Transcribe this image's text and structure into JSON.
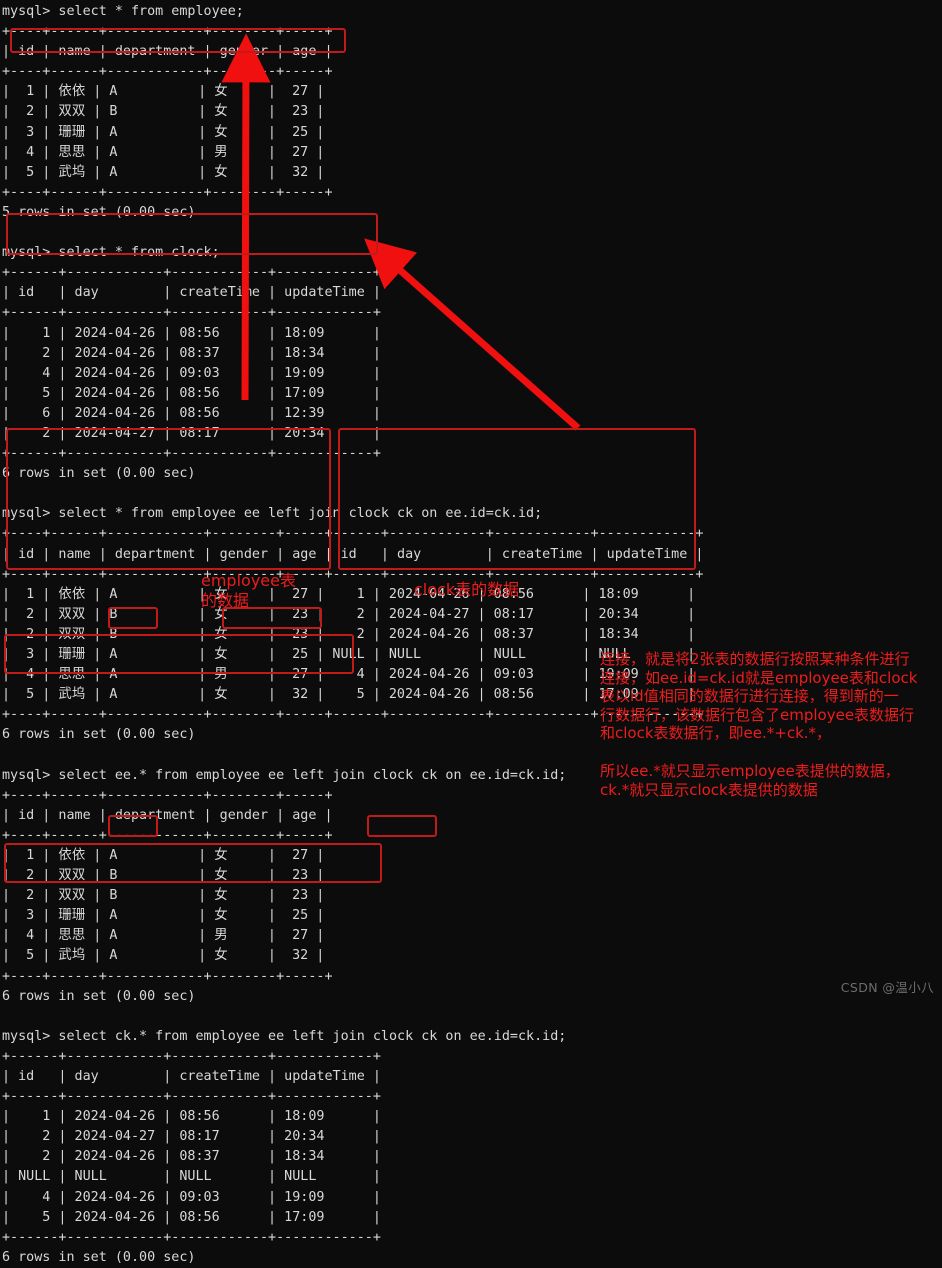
{
  "terminal": {
    "lines": [
      "mysql> select * from employee;",
      "+----+------+------------+--------+-----+",
      "| id | name | department | gender | age |",
      "+----+------+------------+--------+-----+",
      "|  1 | 依依 | A          | 女     |  27 |",
      "|  2 | 双双 | B          | 女     |  23 |",
      "|  3 | 珊珊 | A          | 女     |  25 |",
      "|  4 | 思思 | A          | 男     |  27 |",
      "|  5 | 武坞 | A          | 女     |  32 |",
      "+----+------+------------+--------+-----+",
      "5 rows in set (0.00 sec)",
      "",
      "mysql> select * from clock;",
      "+------+------------+------------+------------+",
      "| id   | day        | createTime | updateTime |",
      "+------+------------+------------+------------+",
      "|    1 | 2024-04-26 | 08:56      | 18:09      |",
      "|    2 | 2024-04-26 | 08:37      | 18:34      |",
      "|    4 | 2024-04-26 | 09:03      | 19:09      |",
      "|    5 | 2024-04-26 | 08:56      | 17:09      |",
      "|    6 | 2024-04-26 | 08:56      | 12:39      |",
      "|    2 | 2024-04-27 | 08:17      | 20:34      |",
      "+------+------------+------------+------------+",
      "6 rows in set (0.00 sec)",
      "",
      "mysql> select * from employee ee left join clock ck on ee.id=ck.id;",
      "+----+------+------------+--------+-----+------+------------+------------+------------+",
      "| id | name | department | gender | age | id   | day        | createTime | updateTime |",
      "+----+------+------------+--------+-----+------+------------+------------+------------+",
      "|  1 | 依依 | A          | 女     |  27 |    1 | 2024-04-26 | 08:56      | 18:09      |",
      "|  2 | 双双 | B          | 女     |  23 |    2 | 2024-04-27 | 08:17      | 20:34      |",
      "|  2 | 双双 | B          | 女     |  23 |    2 | 2024-04-26 | 08:37      | 18:34      |",
      "|  3 | 珊珊 | A          | 女     |  25 | NULL | NULL       | NULL       | NULL       |",
      "|  4 | 思思 | A          | 男     |  27 |    4 | 2024-04-26 | 09:03      | 19:09      |",
      "|  5 | 武坞 | A          | 女     |  32 |    5 | 2024-04-26 | 08:56      | 17:09      |",
      "+----+------+------------+--------+-----+------+------------+------------+------------+",
      "6 rows in set (0.00 sec)",
      "",
      "mysql> select ee.* from employee ee left join clock ck on ee.id=ck.id;",
      "+----+------+------------+--------+-----+",
      "| id | name | department | gender | age |",
      "+----+------+------------+--------+-----+",
      "|  1 | 依依 | A          | 女     |  27 |",
      "|  2 | 双双 | B          | 女     |  23 |",
      "|  2 | 双双 | B          | 女     |  23 |",
      "|  3 | 珊珊 | A          | 女     |  25 |",
      "|  4 | 思思 | A          | 男     |  27 |",
      "|  5 | 武坞 | A          | 女     |  32 |",
      "+----+------+------------+--------+-----+",
      "6 rows in set (0.00 sec)",
      "",
      "mysql> select ck.* from employee ee left join clock ck on ee.id=ck.id;",
      "+------+------------+------------+------------+",
      "| id   | day        | createTime | updateTime |",
      "+------+------------+------------+------------+",
      "|    1 | 2024-04-26 | 08:56      | 18:09      |",
      "|    2 | 2024-04-27 | 08:17      | 20:34      |",
      "|    2 | 2024-04-26 | 08:37      | 18:34      |",
      "| NULL | NULL       | NULL       | NULL       |",
      "|    4 | 2024-04-26 | 09:03      | 19:09      |",
      "|    5 | 2024-04-26 | 08:56      | 17:09      |",
      "+------+------------+------------+------------+",
      "6 rows in set (0.00 sec)"
    ],
    "queries": [
      "select * from employee;",
      "select * from clock;",
      "select * from employee ee left join clock ck on ee.id=ck.id;",
      "select ee.* from employee ee left join clock ck on ee.id=ck.id;",
      "select ck.* from employee ee left join clock ck on ee.id=ck.id;"
    ],
    "prompt": "mysql>",
    "employee_table": {
      "headers": [
        "id",
        "name",
        "department",
        "gender",
        "age"
      ],
      "rows": [
        [
          "1",
          "依依",
          "A",
          "女",
          "27"
        ],
        [
          "2",
          "双双",
          "B",
          "女",
          "23"
        ],
        [
          "3",
          "珊珊",
          "A",
          "女",
          "25"
        ],
        [
          "4",
          "思思",
          "A",
          "男",
          "27"
        ],
        [
          "5",
          "武坞",
          "A",
          "女",
          "32"
        ]
      ],
      "footer": "5 rows in set (0.00 sec)"
    },
    "clock_table": {
      "headers": [
        "id",
        "day",
        "createTime",
        "updateTime"
      ],
      "rows": [
        [
          "1",
          "2024-04-26",
          "08:56",
          "18:09"
        ],
        [
          "2",
          "2024-04-26",
          "08:37",
          "18:34"
        ],
        [
          "4",
          "2024-04-26",
          "09:03",
          "19:09"
        ],
        [
          "5",
          "2024-04-26",
          "08:56",
          "17:09"
        ],
        [
          "6",
          "2024-04-26",
          "08:56",
          "12:39"
        ],
        [
          "2",
          "2024-04-27",
          "08:17",
          "20:34"
        ]
      ],
      "footer": "6 rows in set (0.00 sec)"
    },
    "join_table": {
      "headers": [
        "id",
        "name",
        "department",
        "gender",
        "age",
        "id",
        "day",
        "createTime",
        "updateTime"
      ],
      "rows": [
        [
          "1",
          "依依",
          "A",
          "女",
          "27",
          "1",
          "2024-04-26",
          "08:56",
          "18:09"
        ],
        [
          "2",
          "双双",
          "B",
          "女",
          "23",
          "2",
          "2024-04-27",
          "08:17",
          "20:34"
        ],
        [
          "2",
          "双双",
          "B",
          "女",
          "23",
          "2",
          "2024-04-26",
          "08:37",
          "18:34"
        ],
        [
          "3",
          "珊珊",
          "A",
          "女",
          "25",
          "NULL",
          "NULL",
          "NULL",
          "NULL"
        ],
        [
          "4",
          "思思",
          "A",
          "男",
          "27",
          "4",
          "2024-04-26",
          "09:03",
          "19:09"
        ],
        [
          "5",
          "武坞",
          "A",
          "女",
          "32",
          "5",
          "2024-04-26",
          "08:56",
          "17:09"
        ]
      ],
      "footer": "6 rows in set (0.00 sec)"
    },
    "ee_star_table": {
      "headers": [
        "id",
        "name",
        "department",
        "gender",
        "age"
      ],
      "rows": [
        [
          "1",
          "依依",
          "A",
          "女",
          "27"
        ],
        [
          "2",
          "双双",
          "B",
          "女",
          "23"
        ],
        [
          "2",
          "双双",
          "B",
          "女",
          "23"
        ],
        [
          "3",
          "珊珊",
          "A",
          "女",
          "25"
        ],
        [
          "4",
          "思思",
          "A",
          "男",
          "27"
        ],
        [
          "5",
          "武坞",
          "A",
          "女",
          "32"
        ]
      ],
      "footer": "6 rows in set (0.00 sec)"
    },
    "ck_star_table": {
      "headers": [
        "id",
        "day",
        "createTime",
        "updateTime"
      ],
      "rows": [
        [
          "1",
          "2024-04-26",
          "08:56",
          "18:09"
        ],
        [
          "2",
          "2024-04-27",
          "08:17",
          "20:34"
        ],
        [
          "2",
          "2024-04-26",
          "08:37",
          "18:34"
        ],
        [
          "NULL",
          "NULL",
          "NULL",
          "NULL"
        ],
        [
          "4",
          "2024-04-26",
          "09:03",
          "19:09"
        ],
        [
          "5",
          "2024-04-26",
          "08:56",
          "17:09"
        ]
      ],
      "footer": "6 rows in set (0.00 sec)"
    }
  },
  "annotations": {
    "employee_label": "employee表\n的数据",
    "clock_label": "clock表的数据",
    "explanation": "连接，就是将2张表的数据行按照某种条件进行\n连接，如ee.id=ck.id就是employee表和clock\n表以id值相同的数据行进行连接，得到新的一\n行数据行，该数据行包含了employee表数据行\n和clock表数据行，即ee.*+ck.*，",
    "explanation2": "所以ee.*就只显示employee表提供的数据，\nck.*就只显示clock表提供的数据"
  },
  "watermark": "CSDN @温小八",
  "colors": {
    "background": "#0c0c0c",
    "terminal_text": "#d8d8d8",
    "annotation_red": "#ef1c1c",
    "box_red": "#c01a1a",
    "watermark": "#6d6d6d"
  }
}
